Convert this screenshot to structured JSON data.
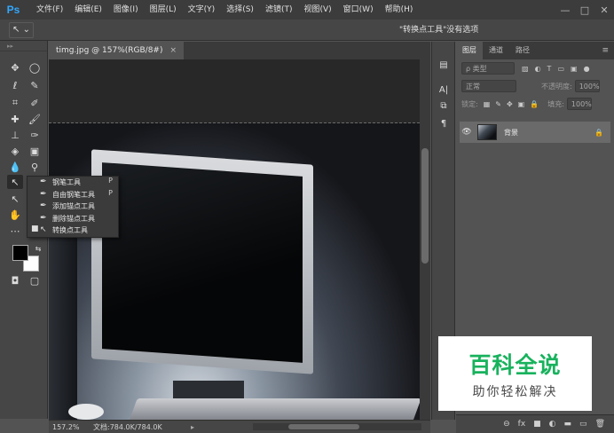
{
  "app": {
    "logo": "Ps"
  },
  "menu": [
    "文件(F)",
    "编辑(E)",
    "图像(I)",
    "图层(L)",
    "文字(Y)",
    "选择(S)",
    "滤镜(T)",
    "视图(V)",
    "窗口(W)",
    "帮助(H)"
  ],
  "window_controls": {
    "minimize": "—",
    "restore": "□",
    "close": "✕"
  },
  "options_bar": {
    "tool_glyph": "↖ ⌄",
    "message": "\"转换点工具\"没有选项",
    "right_glyph": "▸"
  },
  "document": {
    "tab_title": "timg.jpg @ 157%(RGB/8#)",
    "tab_close": "×",
    "status_zoom": "157.2%",
    "status_doc": "文档:784.0K/784.0K",
    "status_arrow": "▸"
  },
  "flyout": {
    "items": [
      {
        "label": "钢笔工具",
        "shortcut": "P",
        "icon": "pen-icon",
        "glyph": "✒",
        "bullet": ""
      },
      {
        "label": "自由钢笔工具",
        "shortcut": "P",
        "icon": "freeform-pen-icon",
        "glyph": "✒",
        "bullet": ""
      },
      {
        "label": "添加锚点工具",
        "shortcut": "",
        "icon": "add-anchor-icon",
        "glyph": "✒",
        "bullet": ""
      },
      {
        "label": "删除锚点工具",
        "shortcut": "",
        "icon": "delete-anchor-icon",
        "glyph": "✒",
        "bullet": ""
      },
      {
        "label": "转换点工具",
        "shortcut": "",
        "icon": "convert-point-icon",
        "glyph": "↖",
        "bullet": "■"
      }
    ]
  },
  "layers_panel": {
    "tabs": [
      "图层",
      "通道",
      "路径"
    ],
    "menu_glyph": "≡",
    "filter_placeholder": "ρ 类型",
    "blend_mode": "正常",
    "opacity_label": "不透明度:",
    "opacity_value": "100%",
    "lock_label": "锁定:",
    "fill_label": "填充:",
    "fill_value": "100%",
    "layers": [
      {
        "name": "背景",
        "visible_glyph": "👁",
        "lock_glyph": "🔒"
      }
    ],
    "footer_glyphs": [
      "⊖",
      "fx",
      "■",
      "◐",
      "▬",
      "▭",
      "🗑"
    ]
  },
  "watermark": {
    "main": "百科全说",
    "sub": "助你轻松解决"
  },
  "colors": {
    "accent": "#31a8ff",
    "watermark_green": "#18b25d"
  }
}
